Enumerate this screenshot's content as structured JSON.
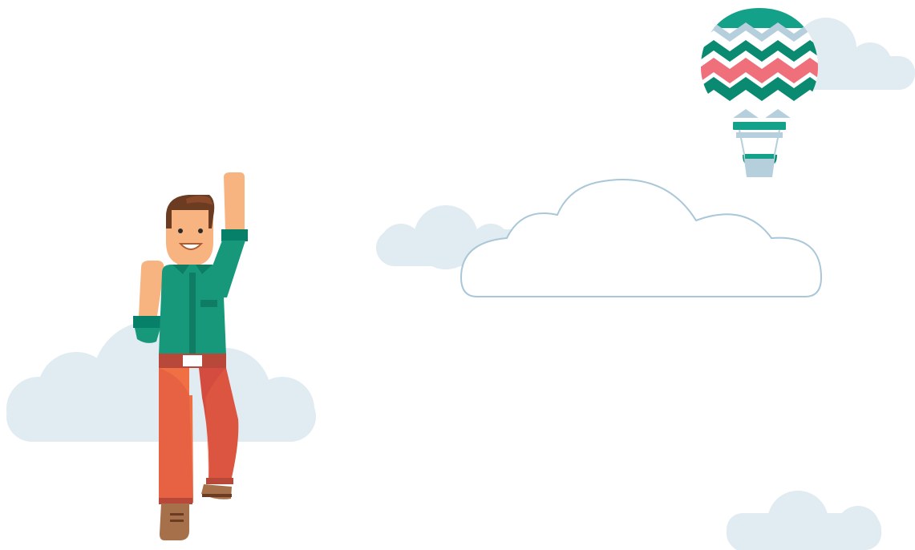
{
  "scene": {
    "background_color": "#ffffff",
    "elements": [
      "cloud",
      "cloud",
      "cloud-outline",
      "cloud",
      "cloud",
      "hot-air-balloon",
      "cheering-man"
    ]
  },
  "colors": {
    "cloud_fill": "#e1ebf2",
    "cloud_outline": "#a9c7d8",
    "balloon_teal": "#13a18a",
    "balloon_dark_teal": "#0b8a72",
    "balloon_light_blue": "#b6cfdc",
    "balloon_pink": "#ef6f7a",
    "skin": "#f8b480",
    "hair": "#6b3b22",
    "shirt": "#17987a",
    "shirt_dark": "#0e7d63",
    "cuffs": "#07806a",
    "pants_main": "#f07044",
    "pants_dark": "#d44c3f",
    "boots": "#a6714a"
  }
}
